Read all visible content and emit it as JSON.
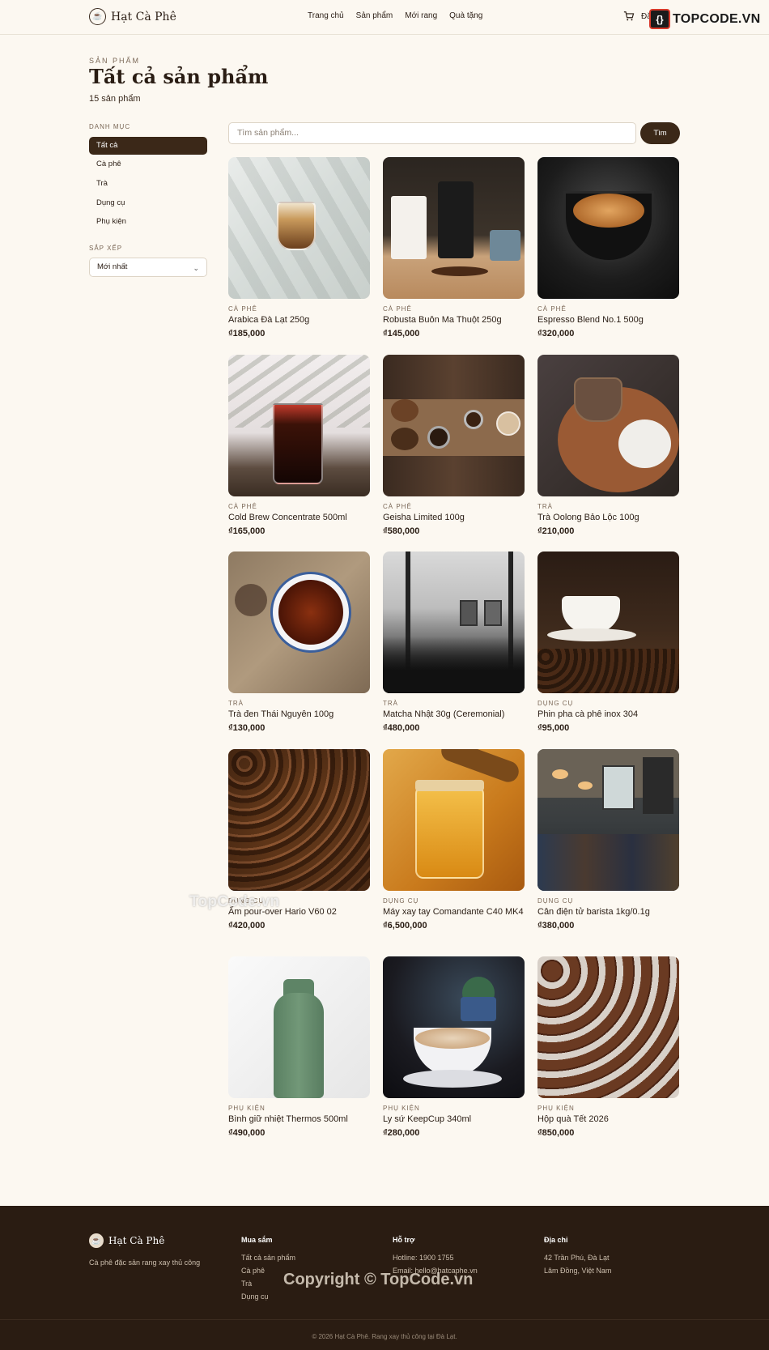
{
  "header": {
    "logo_text": "Hạt Cà Phê",
    "nav": [
      "Trang chủ",
      "Sản phẩm",
      "Mới rang",
      "Quà tặng"
    ],
    "login_partial": "Đă",
    "watermark_brand": "TOPCODE.VN"
  },
  "page": {
    "eyebrow": "SẢN PHẨM",
    "title": "Tất cả sản phẩm",
    "count": "15 sản phẩm"
  },
  "sidebar": {
    "category_label": "DANH MỤC",
    "categories": [
      "Tất cả",
      "Cà phê",
      "Trà",
      "Dụng cụ",
      "Phụ kiện"
    ],
    "sort_label": "SẮP XẾP",
    "sort_value": "Mới nhất"
  },
  "search": {
    "placeholder": "Tìm sản phẩm...",
    "button": "Tìm"
  },
  "products": [
    {
      "category": "CÀ PHÊ",
      "name": "Arabica Đà Lạt 250g",
      "price": "₫185,000"
    },
    {
      "category": "CÀ PHÊ",
      "name": "Robusta Buôn Ma Thuột 250g",
      "price": "₫145,000"
    },
    {
      "category": "CÀ PHÊ",
      "name": "Espresso Blend No.1 500g",
      "price": "₫320,000"
    },
    {
      "category": "CÀ PHÊ",
      "name": "Cold Brew Concentrate 500ml",
      "price": "₫165,000"
    },
    {
      "category": "CÀ PHÊ",
      "name": "Geisha Limited 100g",
      "price": "₫580,000"
    },
    {
      "category": "TRÀ",
      "name": "Trà Oolong Bảo Lộc 100g",
      "price": "₫210,000"
    },
    {
      "category": "TRÀ",
      "name": "Trà đen Thái Nguyên 100g",
      "price": "₫130,000"
    },
    {
      "category": "TRÀ",
      "name": "Matcha Nhật 30g (Ceremonial)",
      "price": "₫480,000"
    },
    {
      "category": "DỤNG CỤ",
      "name": "Phin pha cà phê inox 304",
      "price": "₫95,000"
    },
    {
      "category": "DỤNG CỤ",
      "name": "Ấm pour-over Hario V60 02",
      "price": "₫420,000"
    },
    {
      "category": "DỤNG CỤ",
      "name": "Máy xay tay Comandante C40 MK4",
      "price": "₫6,500,000"
    },
    {
      "category": "DỤNG CỤ",
      "name": "Cân điện tử barista 1kg/0.1g",
      "price": "₫380,000"
    },
    {
      "category": "PHỤ KIỆN",
      "name": "Bình giữ nhiệt Thermos 500ml",
      "price": "₫490,000"
    },
    {
      "category": "PHỤ KIỆN",
      "name": "Ly sứ KeepCup 340ml",
      "price": "₫280,000"
    },
    {
      "category": "PHỤ KIỆN",
      "name": "Hộp quà Tết 2026",
      "price": "₫850,000"
    }
  ],
  "watermark_mid": "TopCode.vn",
  "footer": {
    "logo_text": "Hạt Cà Phê",
    "tagline": "Cà phê đặc sản rang xay thủ công",
    "shop_heading": "Mua sắm",
    "shop_links": [
      "Tất cả sản phẩm",
      "Cà phê",
      "Trà",
      "Dụng cụ"
    ],
    "support_heading": "Hỗ trợ",
    "support_lines": [
      "Hotline: 1900 1755",
      "Email: hello@hatcaphe.vn"
    ],
    "address_heading": "Địa chỉ",
    "address_lines": [
      "42 Trần Phú, Đà Lạt",
      "Lâm Đồng, Việt Nam"
    ],
    "watermark": "Copyright © TopCode.vn",
    "copyright": "© 2026 Hạt Cà Phê. Rang xay thủ công tại Đà Lạt."
  },
  "colors": {
    "background": "#fcf8f1",
    "accent": "#3b2818",
    "footer": "#2a1c12"
  }
}
